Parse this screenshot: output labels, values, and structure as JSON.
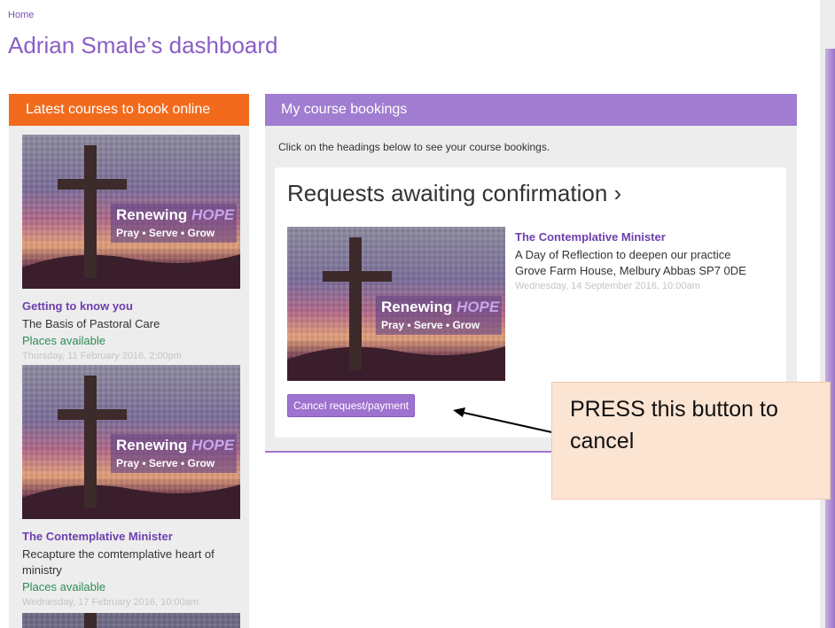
{
  "breadcrumb": "Home",
  "page_title": "Adrian Smale’s dashboard",
  "left_panel": {
    "header": "Latest courses to book online",
    "image_text": {
      "line1a": "Renewing ",
      "line1b": "HOPE",
      "line2": "Pray • Serve • Grow"
    },
    "courses": [
      {
        "title": "Getting to know you",
        "subtitle": "The Basis of Pastoral Care",
        "status": "Places available",
        "date": "Thursday, 11 February 2016, 2:00pm"
      },
      {
        "title": "The Contemplative Minister",
        "subtitle": "Recapture the comtemplative heart of ministry",
        "status": "Places available",
        "date": "Wednesday, 17 February 2016, 10:00am"
      }
    ]
  },
  "right_panel": {
    "header": "My course bookings",
    "instructions": "Click on the headings below to see your course bookings.",
    "section_heading": "Requests awaiting confirmation ›",
    "booking": {
      "title": "The Contemplative Minister",
      "description": "A Day of Reflection to deepen our practice",
      "location": "Grove Farm House, Melbury Abbas SP7 0DE",
      "date": "Wednesday, 14 September 2016, 10:00am",
      "cancel_label": "Cancel request/payment"
    }
  },
  "annotation": {
    "text": "PRESS this button to cancel"
  },
  "colors": {
    "orange": "#f26b1d",
    "purple": "#a07dd0",
    "link_purple": "#6d3fae",
    "green": "#2e8b57",
    "note_bg": "#fce4d3"
  }
}
